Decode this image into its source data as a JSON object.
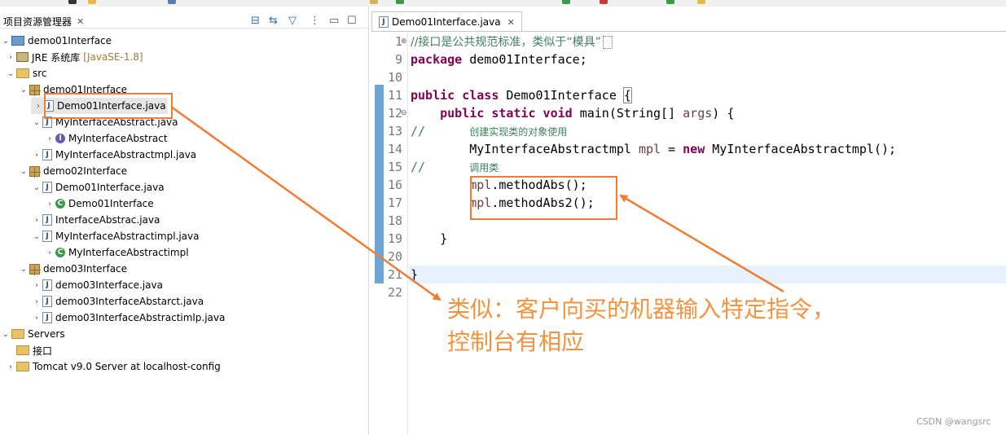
{
  "explorer": {
    "title": "项目资源管理器",
    "close_glyph": "✕",
    "toolbar_icons": [
      "collapse-all-icon",
      "link-with-editor-icon",
      "filter-icon",
      "view-menu-icon",
      "minimize-icon",
      "maximize-icon"
    ],
    "tree": [
      {
        "label": "demo01Interface",
        "icon": "project-icon",
        "expanded": true
      },
      {
        "label": "JRE 系统库",
        "tag": "[JavaSE-1.8]",
        "icon": "library-icon",
        "expanded": false
      },
      {
        "label": "src",
        "icon": "source-folder-icon",
        "expanded": true
      },
      {
        "label": "demo01Interface",
        "icon": "package-icon",
        "expanded": true
      },
      {
        "label": "Demo01Interface.java",
        "icon": "java-file-icon",
        "expanded": false,
        "selected": true
      },
      {
        "label": "MyInterfaceAbstract.java",
        "icon": "java-interface-file-icon",
        "expanded": true
      },
      {
        "label": "MyInterfaceAbstract",
        "icon": "interface-icon",
        "expanded": false
      },
      {
        "label": "MyInterfaceAbstractmpl.java",
        "icon": "java-file-icon",
        "expanded": false
      },
      {
        "label": "demo02Interface",
        "icon": "package-icon",
        "expanded": true
      },
      {
        "label": "Demo01Interface.java",
        "icon": "java-file-icon",
        "expanded": true
      },
      {
        "label": "Demo01Interface",
        "icon": "main-class-icon",
        "expanded": false
      },
      {
        "label": "InterfaceAbstrac.java",
        "icon": "java-interface-file-icon",
        "expanded": false
      },
      {
        "label": "MyInterfaceAbstractimpl.java",
        "icon": "java-file-icon",
        "expanded": true
      },
      {
        "label": "MyInterfaceAbstractimpl",
        "icon": "class-icon",
        "expanded": false
      },
      {
        "label": "demo03Interface",
        "icon": "package-icon",
        "expanded": true
      },
      {
        "label": "demo03Interface.java",
        "icon": "java-file-icon",
        "expanded": false
      },
      {
        "label": "demo03InterfaceAbstarct.java",
        "icon": "java-interface-file-icon",
        "expanded": false
      },
      {
        "label": "demo03InterfaceAbstractimlp.java",
        "icon": "java-file-icon",
        "expanded": false
      },
      {
        "label": "Servers",
        "icon": "servers-icon",
        "expanded": true
      },
      {
        "label": "接口",
        "icon": "folder-icon",
        "expanded": false
      },
      {
        "label": "Tomcat v9.0 Server at localhost-config",
        "icon": "folder-icon",
        "expanded": false
      }
    ]
  },
  "editor": {
    "tab_label": "Demo01Interface.java",
    "tab_close": "✕",
    "line_numbers": [
      "1",
      "9",
      "10",
      "11",
      "12",
      "13",
      "14",
      "15",
      "16",
      "17",
      "18",
      "19",
      "20",
      "21",
      "22"
    ],
    "code": {
      "l1": "//接口是公共规范标准，类似于“模具”",
      "l9_kw": "package",
      "l9_rest": " demo01Interface;",
      "l11_kw": "public class",
      "l11_rest": " Demo01Interface ",
      "l11_brace": "{",
      "l12_kw": "public static void",
      "l12_rest": " main(String[] ",
      "l12_arg": "args",
      "l12_end": ") {",
      "l13_cm": "//",
      "l13_cn": "创建实现类的对象使用",
      "l14_type": "MyInterfaceAbstractmpl ",
      "l14_var": "mpl",
      "l14_eq": " = ",
      "l14_kw": "new",
      "l14_rest": " MyInterfaceAbstractmpl();",
      "l15_cm": "//",
      "l15_cn": "调用类",
      "l16_var": "mpl",
      "l16_rest": ".methodAbs();",
      "l17_var": "mpl",
      "l17_rest": ".methodAbs2();",
      "l19": "}",
      "l21": "}"
    }
  },
  "annotation": {
    "line1": "类似：客户向买的机器输入特定指令，",
    "line2": "控制台有相应",
    "color": "#f3923f"
  },
  "watermark": "CSDN @wangsrc"
}
